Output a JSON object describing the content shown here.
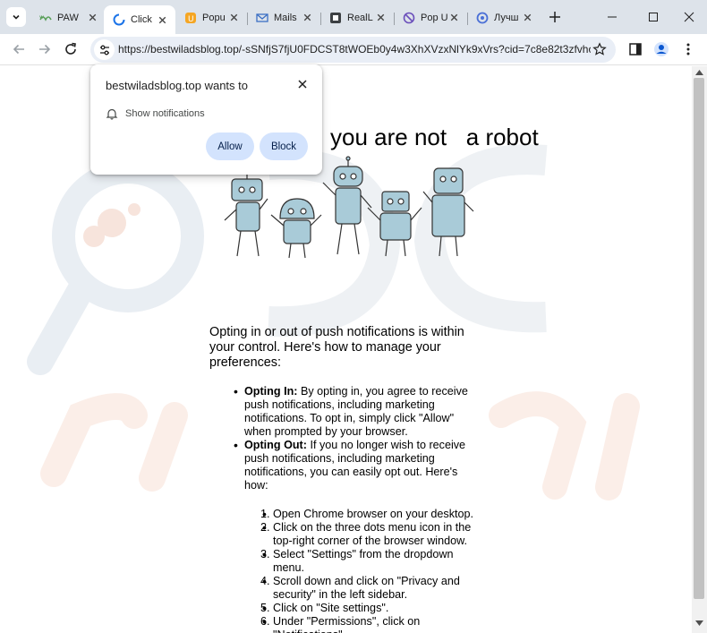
{
  "tabs": [
    {
      "title": "PAW",
      "icon": "pawns-favicon-icon",
      "active": false
    },
    {
      "title": "Click",
      "icon": "loading-spinner-icon",
      "active": true
    },
    {
      "title": "Popu",
      "icon": "popup-favicon-icon",
      "active": false
    },
    {
      "title": "Mails",
      "icon": "mail-icon",
      "active": false
    },
    {
      "title": "RealL",
      "icon": "reall-favicon-icon",
      "active": false
    },
    {
      "title": "Pop U",
      "icon": "blocked-icon",
      "active": false
    },
    {
      "title": "Лучш",
      "icon": "luchsh-favicon-icon",
      "active": false
    }
  ],
  "toolbar": {
    "url": "https://bestwiladsblog.top/-sSNfjS7fjU0FDCST8tWOEb0y4w3XhXVzxNlYk9xVrs?cid=7c8e82t3zfvho3y22..."
  },
  "popup": {
    "title": "bestwiladsblog.top wants to",
    "permission": "Show notifications",
    "allow_label": "Allow",
    "block_label": "Block"
  },
  "page": {
    "headline": "you are not   a robot",
    "intro": "Opting in or out of push notifications is within your control. Here's how to manage your preferences:",
    "bullets": [
      {
        "title": "Opting In:",
        "text": " By opting in, you agree to receive push notifications, including marketing notifications. To opt in, simply click \"Allow\" when prompted by your browser."
      },
      {
        "title": "Opting Out:",
        "text": " If you no longer wish to receive push notifications, including marketing notifications, you can easily opt out. Here's how:"
      }
    ],
    "steps": [
      {
        "num": "1.",
        "text": "Open Chrome browser on your desktop."
      },
      {
        "num": "2.",
        "text": "Click on the three dots menu icon in the top-right corner of the browser window."
      },
      {
        "num": "3.",
        "text": "Select \"Settings\" from the dropdown menu."
      },
      {
        "num": "4.",
        "text": "Scroll down and click on \"Privacy and security\" in the left sidebar."
      },
      {
        "num": "5.",
        "text": "Click on \"Site settings\"."
      },
      {
        "num": "6.",
        "text": "Under \"Permissions\", click on \"Notifications\"."
      }
    ]
  },
  "colors": {
    "tabstrip": "#dde3ea",
    "omnibox": "#e9eef6",
    "button_bg": "#d3e3fd",
    "button_text": "#041e49",
    "robot_body": "#a9cbd8"
  }
}
